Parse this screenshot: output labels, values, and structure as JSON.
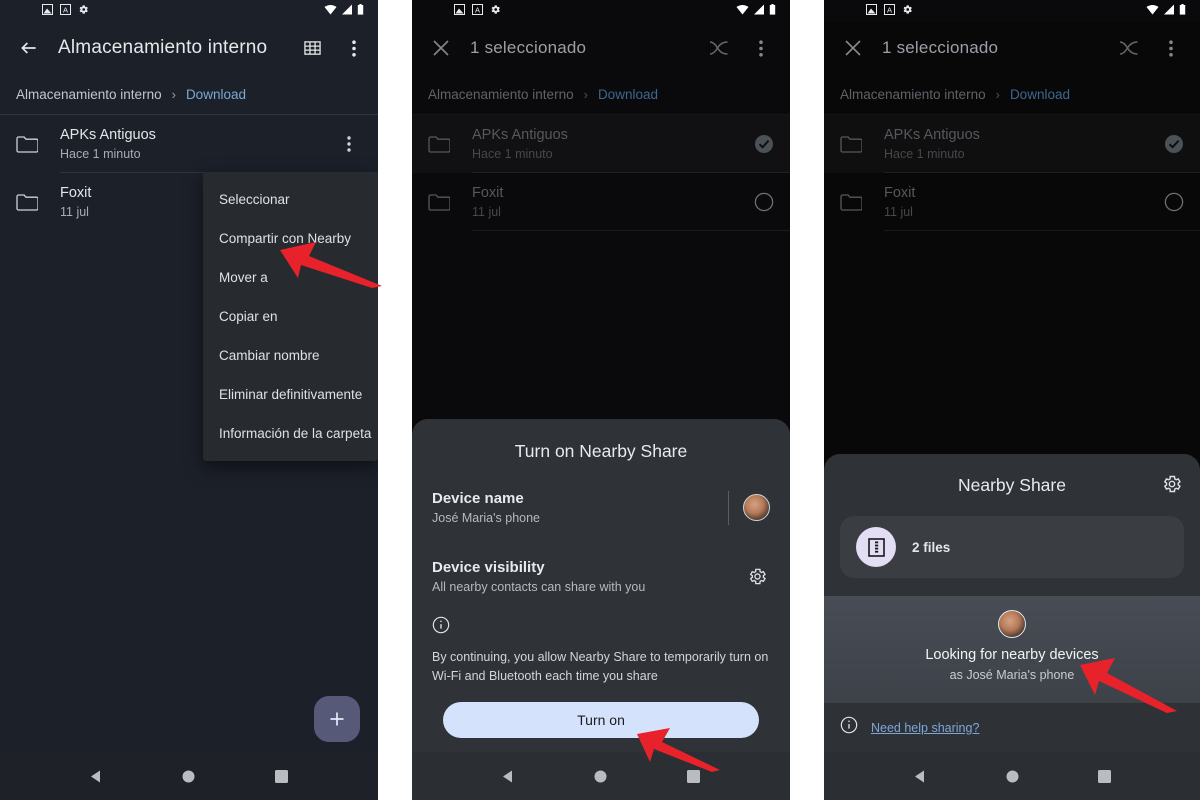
{
  "statusbar": {
    "notif_icons": [
      "image-icon",
      "app-icon",
      "gear-icon"
    ],
    "system_icons": [
      "wifi-icon",
      "signal-icon",
      "battery-icon"
    ]
  },
  "panel1": {
    "toolbar": {
      "title": "Almacenamiento interno",
      "back": "back-arrow",
      "grid": "grid-view-icon",
      "overflow": "overflow-menu-icon"
    },
    "breadcrumb": {
      "root": "Almacenamiento interno",
      "separator": "›",
      "current": "Download"
    },
    "files": [
      {
        "name": "APKs Antiguos",
        "sub": "Hace 1 minuto"
      },
      {
        "name": "Foxit",
        "sub": "11 jul"
      }
    ],
    "context_menu": [
      "Seleccionar",
      "Compartir con Nearby",
      "Mover a",
      "Copiar en",
      "Cambiar nombre",
      "Eliminar definitivamente",
      "Información de la carpeta"
    ],
    "fab_label": "+"
  },
  "panel2": {
    "toolbar": {
      "title": "1 seleccionado",
      "close": "close-icon",
      "share": "nearby-share-icon",
      "overflow": "overflow-menu-icon"
    },
    "breadcrumb": {
      "root": "Almacenamiento interno",
      "separator": "›",
      "current": "Download"
    },
    "files": [
      {
        "name": "APKs Antiguos",
        "sub": "Hace 1 minuto",
        "selected": true
      },
      {
        "name": "Foxit",
        "sub": "11 jul",
        "selected": false
      }
    ],
    "sheet": {
      "title": "Turn on Nearby Share",
      "device_name_label": "Device name",
      "device_name_value": "José Maria's phone",
      "device_visibility_label": "Device visibility",
      "device_visibility_value": "All nearby contacts can share with you",
      "info_text": "By continuing, you allow Nearby Share to temporarily turn on Wi-Fi and Bluetooth each time you share",
      "turn_on_button": "Turn on"
    }
  },
  "panel3": {
    "toolbar": {
      "title": "1 seleccionado",
      "close": "close-icon",
      "share": "nearby-share-icon",
      "overflow": "overflow-menu-icon"
    },
    "breadcrumb": {
      "root": "Almacenamiento interno",
      "separator": "›",
      "current": "Download"
    },
    "files": [
      {
        "name": "APKs Antiguos",
        "sub": "Hace 1 minuto",
        "selected": true
      },
      {
        "name": "Foxit",
        "sub": "11 jul",
        "selected": false
      }
    ],
    "sheet": {
      "title": "Nearby Share",
      "files_count_label": "2 files",
      "scanning_title": "Looking for nearby devices",
      "scanning_sub": "as José Maria's phone",
      "help_link": "Need help sharing?"
    }
  },
  "navbar": {
    "back": "nav-back-triangle",
    "home": "nav-home-circle",
    "recents": "nav-recents-square"
  },
  "colors": {
    "accent_blue": "#7ba7d7",
    "button_bg": "#d5e2fb",
    "fab_bg": "#565a78",
    "arrow_red": "#e8222a",
    "sheet_bg": "#2f3236"
  }
}
